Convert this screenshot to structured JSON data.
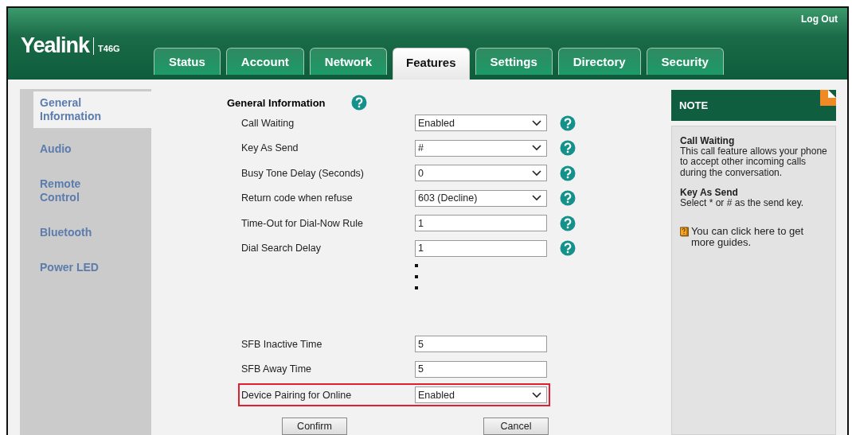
{
  "header": {
    "logo": "Yealink",
    "model": "T46G",
    "logout": "Log Out"
  },
  "tabs": [
    {
      "label": "Status",
      "selected": false
    },
    {
      "label": "Account",
      "selected": false
    },
    {
      "label": "Network",
      "selected": false
    },
    {
      "label": "Features",
      "selected": true
    },
    {
      "label": "Settings",
      "selected": false
    },
    {
      "label": "Directory",
      "selected": false
    },
    {
      "label": "Security",
      "selected": false
    }
  ],
  "sidebar": {
    "items": [
      {
        "label": "General Information",
        "selected": true
      },
      {
        "label": "Audio",
        "selected": false
      },
      {
        "label": "Remote Control",
        "selected": false
      },
      {
        "label": "Bluetooth",
        "selected": false
      },
      {
        "label": "Power LED",
        "selected": false
      }
    ]
  },
  "form": {
    "title": "General Information",
    "rows": [
      {
        "label": "Call Waiting",
        "kind": "select",
        "value": "Enabled",
        "help": true,
        "highlighted": false
      },
      {
        "label": "Key As Send",
        "kind": "select",
        "value": "#",
        "help": true,
        "highlighted": false
      },
      {
        "label": "Busy Tone Delay (Seconds)",
        "kind": "select",
        "value": "0",
        "help": true,
        "highlighted": false
      },
      {
        "label": "Return code when refuse",
        "kind": "select",
        "value": "603 (Decline)",
        "help": true,
        "highlighted": false
      },
      {
        "label": "Time-Out for Dial-Now Rule",
        "kind": "text",
        "value": "1",
        "help": true,
        "highlighted": false
      },
      {
        "label": "Dial Search Delay",
        "kind": "text",
        "value": "1",
        "help": true,
        "highlighted": false
      },
      {
        "kind": "gap"
      },
      {
        "label": "SFB Inactive Time",
        "kind": "text",
        "value": "5",
        "help": false,
        "highlighted": false
      },
      {
        "label": "SFB Away Time",
        "kind": "text",
        "value": "5",
        "help": false,
        "highlighted": false
      },
      {
        "label": "Device Pairing for Online",
        "kind": "select",
        "value": "Enabled",
        "help": false,
        "highlighted": true
      }
    ],
    "buttons": [
      "Confirm",
      "Cancel"
    ]
  },
  "note": {
    "title": "NOTE",
    "entries": [
      {
        "title": "Call Waiting",
        "text": "This call feature allows your phone to accept other incoming calls during the conversation."
      },
      {
        "title": "Key As Send",
        "text": "Select * or # as the send key."
      }
    ],
    "guide": "You can click here to get more guides."
  }
}
